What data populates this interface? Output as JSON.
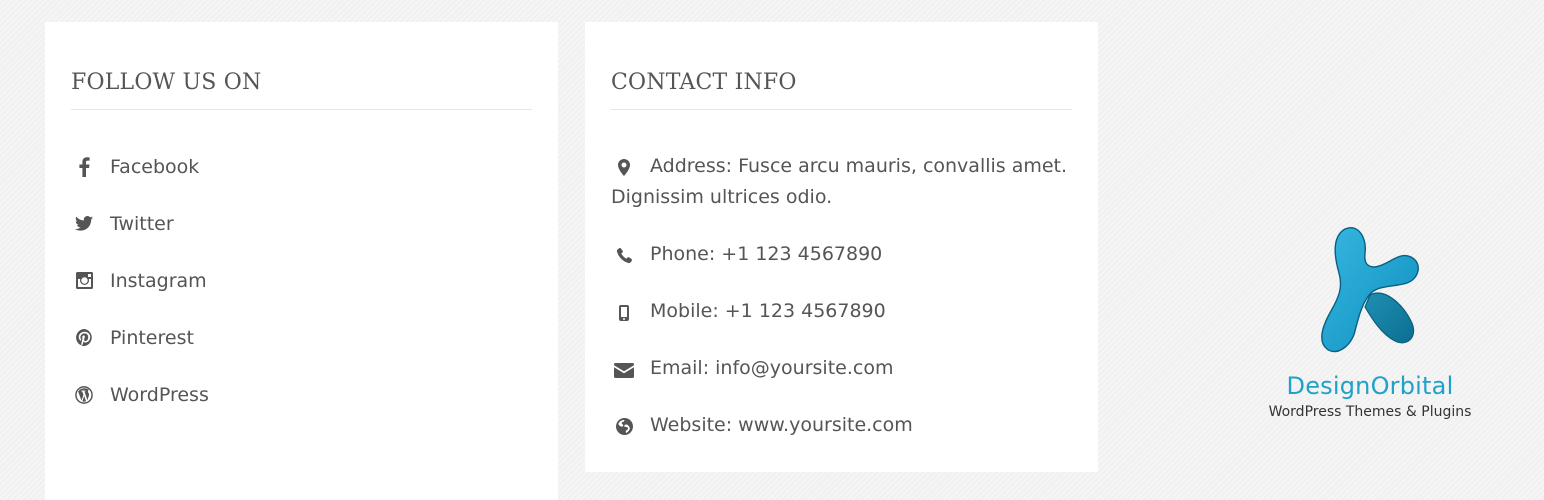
{
  "follow": {
    "title": "FOLLOW US ON",
    "items": [
      {
        "label": "Facebook",
        "icon": "facebook-icon"
      },
      {
        "label": "Twitter",
        "icon": "twitter-icon"
      },
      {
        "label": "Instagram",
        "icon": "instagram-icon"
      },
      {
        "label": "Pinterest",
        "icon": "pinterest-icon"
      },
      {
        "label": "WordPress",
        "icon": "wordpress-icon"
      }
    ]
  },
  "contact": {
    "title": "CONTACT INFO",
    "items": [
      {
        "text": "Address: Fusce arcu mauris, convallis amet. Dignissim ultrices odio.",
        "icon": "map-marker-icon"
      },
      {
        "text": "Phone: +1 123 4567890",
        "icon": "phone-icon"
      },
      {
        "text": "Mobile: +1 123 4567890",
        "icon": "mobile-icon"
      },
      {
        "text": "Email: info@yoursite.com",
        "icon": "envelope-icon"
      },
      {
        "text": "Website: www.yoursite.com",
        "icon": "globe-icon"
      }
    ]
  },
  "logo": {
    "brand": "DesignOrbital",
    "tagline": "WordPress Themes & Plugins",
    "colors": {
      "primary": "#1ea2c9",
      "dark": "#0e7fa3"
    }
  }
}
